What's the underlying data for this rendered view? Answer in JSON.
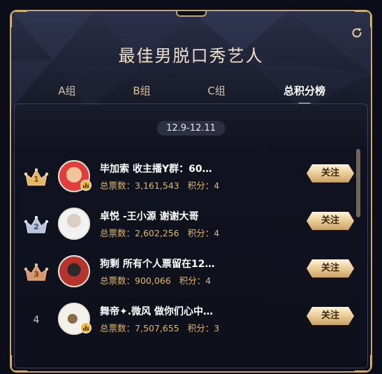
{
  "header": {
    "title": "最佳男脱口秀艺人"
  },
  "tabs": [
    {
      "label": "A组"
    },
    {
      "label": "B组"
    },
    {
      "label": "C组"
    },
    {
      "label": "总积分榜",
      "active": true
    }
  ],
  "date_range": "12.9-12.11",
  "follow_label": "关注",
  "entries": [
    {
      "rank": "1",
      "name": "毕加索 收主播Y群：60…",
      "votes_label": "总票数：",
      "votes": "3,161,543",
      "score_label": "积分：",
      "score": "4"
    },
    {
      "rank": "2",
      "name": "卓悦 -王小源 谢谢大哥",
      "votes_label": "总票数：",
      "votes": "2,602,256",
      "score_label": "积分：",
      "score": "4"
    },
    {
      "rank": "3",
      "name": "狗剩 所有个人票留在12…",
      "votes_label": "总票数：",
      "votes": "900,066",
      "score_label": "积分：",
      "score": "4"
    },
    {
      "rank": "4",
      "name": "舞帝✦.微风 做你们心中…",
      "votes_label": "总票数：",
      "votes": "7,507,655",
      "score_label": "积分：",
      "score": "3"
    }
  ],
  "colors": {
    "gold_border": "#c9a46a",
    "gold_text": "#e1b964",
    "crown_gold": "#e6b566",
    "crown_silver": "#b9c4dc",
    "crown_bronze": "#d8966b"
  }
}
